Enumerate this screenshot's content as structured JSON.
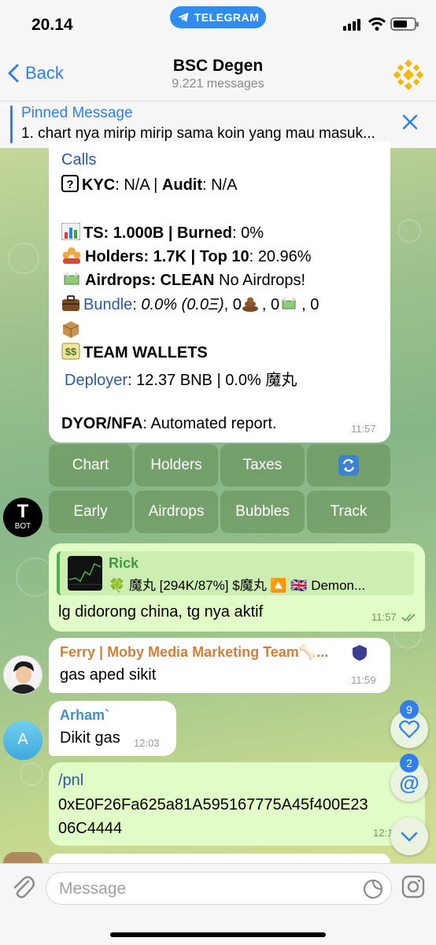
{
  "status_bar": {
    "time": "20.14",
    "pill_label": "TELEGRAM"
  },
  "header": {
    "back_label": "Back",
    "title": "BSC Degen",
    "subtitle": "9.221 messages"
  },
  "pinned": {
    "title": "Pinned Message",
    "text": "1. chart nya mirip mirip sama koin yang mau masuk..."
  },
  "bot_card": {
    "calls": "Calls",
    "kyc_label": "KYC",
    "kyc_value": ": N/A | ",
    "audit_label": "Audit",
    "audit_value": ": N/A",
    "ts_label": "TS: 1.000B | Burned",
    "ts_value": ": 0%",
    "holders_label": "Holders: 1.7K | Top 10",
    "holders_value": ": 20.96%",
    "airdrops_label": "Airdrops: CLEAN",
    "airdrops_value": " No Airdrops!",
    "bundle_label": "Bundle",
    "bundle_colon": ": ",
    "bundle_value": "0.0% (0.0Ξ)",
    "bundle_rest": ", 0",
    "bundle_b": ", 0",
    "bundle_c": ", 0",
    "team_wallets": "TEAM WALLETS",
    "deployer_label": "Deployer",
    "deployer_value": ": 12.37 BNB | 0.0% 魔丸",
    "dyor_label": "DYOR/NFA",
    "dyor_value": ": Automated report.",
    "time": "11:57"
  },
  "keyboard": {
    "row1": [
      "Chart",
      "Holders",
      "Taxes",
      "🔃"
    ],
    "row2": [
      "Early",
      "Airdrops",
      "Bubbles",
      "Track"
    ]
  },
  "bot_avatar": {
    "letter": "T",
    "label": "BOT"
  },
  "msg_rick": {
    "reply_name": "Rick",
    "reply_text": "🍀 魔丸 [294K/87%] $魔丸 🔼 🇬🇧 Demon...",
    "text": "lg didorong china, tg nya aktif",
    "time": "11:57"
  },
  "msg_ferry": {
    "name": "Ferry | Moby Media Marketing Team🦴...",
    "text": "gas aped sikit",
    "time": "11:59"
  },
  "msg_arham": {
    "name": "Arham`",
    "avatar_letter": "A",
    "text": "Dikit gas",
    "time": "12:03"
  },
  "msg_pnl": {
    "line1": "/pnl",
    "line2": "0xE0F26Fa625a81A595167775A45f400E23",
    "line3": "06C4444",
    "time": "12:1"
  },
  "floating": {
    "likes_count": "9",
    "mentions_count": "2"
  },
  "input": {
    "placeholder": "Message"
  },
  "colors": {
    "accent": "#2f7ff0",
    "bnb": "#f0b90b",
    "outgoing": "#e2fcc8"
  }
}
